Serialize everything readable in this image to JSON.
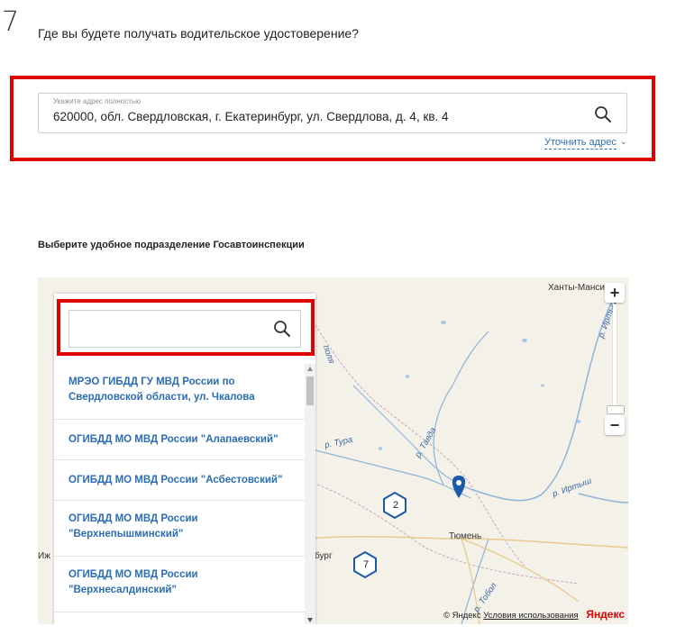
{
  "step": {
    "number": "7",
    "question": "Где вы будете получать водительское удостоверение?"
  },
  "address": {
    "label": "Укажите адрес полностью",
    "value": "620000, обл. Свердловская, г. Екатеринбург, ул. Свердлова, д. 4, кв. 4",
    "refine_link": "Уточнить адрес",
    "refine_chevron": "⌄"
  },
  "section": {
    "title": "Выберите удобное подразделение Госавтоинспекции"
  },
  "panel": {
    "search_value": "",
    "items": [
      "МРЭО ГИБДД ГУ МВД России по Свердловской области, ул. Чкалова",
      "ОГИБДД МО МВД России \"Алапаевский\"",
      "ОГИБДД МО МВД России \"Асбестовский\"",
      "ОГИБДД МО МВД России \"Верхнепышминский\"",
      "ОГИБДД МО МВД России \"Верхнесалдинский\""
    ]
  },
  "map": {
    "places": {
      "khanty": "Ханты-Манси",
      "tyumen": "Тюмень",
      "izh": "Иж",
      "burg": "бург"
    },
    "rivers": {
      "tura": "р. Тура",
      "tavda": "р. Тавда",
      "irtysh": "р. Иртыш",
      "irtysh_north": "р. Иртыш",
      "polya": "поля",
      "tobol": "р. Тобол"
    },
    "clusters": [
      {
        "count": "2"
      },
      {
        "count": "7"
      }
    ],
    "zoom_in": "+",
    "zoom_out": "−",
    "copyright": "© Яндекс",
    "terms": "Условия использования",
    "brand": "Яндекс"
  },
  "colors": {
    "accent": "#2b6db8",
    "highlight": "#e00000",
    "marker": "#1a5aa6"
  }
}
